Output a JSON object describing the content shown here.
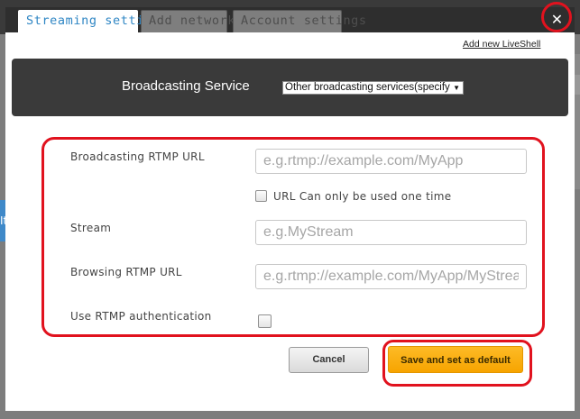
{
  "background": {
    "left_tab_fragment": "It"
  },
  "tabs": [
    {
      "label": "Streaming setting",
      "active": true
    },
    {
      "label": "Add network",
      "active": false
    },
    {
      "label": "Account settings",
      "active": false
    }
  ],
  "close_icon": "close-icon",
  "add_liveshell_link": "Add new LiveShell",
  "service": {
    "label": "Broadcasting Service",
    "selected": "Other broadcasting services(specify"
  },
  "form": {
    "rtmp_url_label": "Broadcasting RTMP URL",
    "rtmp_url_placeholder": "e.g.rtmp://example.com/MyApp",
    "one_time_label": "URL Can only be used one time",
    "stream_label": "Stream",
    "stream_placeholder": "e.g.MyStream",
    "browsing_url_label": "Browsing RTMP URL",
    "browsing_url_placeholder": "e.g.rtmp://example.com/MyApp/MyStream",
    "auth_label": "Use RTMP authentication"
  },
  "buttons": {
    "cancel": "Cancel",
    "save": "Save and set as default"
  },
  "colors": {
    "accent_tab_text": "#2f86c4",
    "highlight_red": "#e1121e",
    "save_button": "#f7a400",
    "service_bar": "#3a3a3a"
  }
}
